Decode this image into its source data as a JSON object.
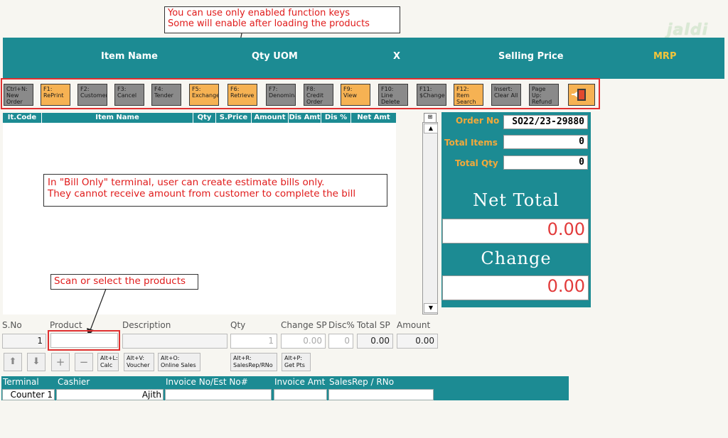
{
  "callouts": {
    "top_line1": "You can use only enabled function keys",
    "top_line2": "Some will enable after loading the products",
    "mid_line1": "In \"Bill Only\" terminal, user can create estimate bills only.",
    "mid_line2": "They cannot receive amount from customer to complete the bill",
    "scan": "Scan or select the products"
  },
  "logo": "jaldi",
  "header": {
    "item_name": "Item Name",
    "qty_uom": "Qty UOM",
    "x": "X",
    "selling_price": "Selling Price",
    "mrp": "MRP"
  },
  "fkeys": [
    {
      "line1": "Ctrl+N:",
      "line2": "New",
      "line3": "Order",
      "enabled": false
    },
    {
      "line1": "F1:",
      "line2": "RePrint",
      "line3": "",
      "enabled": true
    },
    {
      "line1": "F2:",
      "line2": "Customer",
      "line3": "",
      "enabled": false
    },
    {
      "line1": "F3:",
      "line2": "Cancel",
      "line3": "",
      "enabled": false
    },
    {
      "line1": "F4:",
      "line2": "Tender",
      "line3": "",
      "enabled": false
    },
    {
      "line1": "F5:",
      "line2": "Exchange",
      "line3": "",
      "enabled": true
    },
    {
      "line1": "F6:",
      "line2": "Retrieve",
      "line3": "",
      "enabled": true
    },
    {
      "line1": "F7:",
      "line2": "Denomina",
      "line3": "",
      "enabled": false
    },
    {
      "line1": "F8:",
      "line2": "Credit",
      "line3": "Order",
      "enabled": false
    },
    {
      "line1": "F9:",
      "line2": "View",
      "line3": "",
      "enabled": true
    },
    {
      "line1": "F10:",
      "line2": "Line",
      "line3": "Delete",
      "enabled": false
    },
    {
      "line1": "F11:",
      "line2": "$Change",
      "line3": "",
      "enabled": false
    },
    {
      "line1": "F12:",
      "line2": "Item",
      "line3": "Search",
      "enabled": true
    },
    {
      "line1": "Insert:",
      "line2": "Clear All",
      "line3": "",
      "enabled": false
    },
    {
      "line1": "Page Up:",
      "line2": "Refund",
      "line3": "",
      "enabled": false
    }
  ],
  "grid_columns": [
    "It.Code",
    "Item Name",
    "Qty",
    "S.Price",
    "Amount",
    "Dis Amt",
    "Dis %",
    "Net Amt"
  ],
  "summary": {
    "order_no_label": "Order No",
    "order_no": "SO22/23-29880",
    "total_items_label": "Total Items",
    "total_items": "0",
    "total_qty_label": "Total Qty",
    "total_qty": "0",
    "net_total_label": "Net Total",
    "net_total": "0.00",
    "change_label": "Change",
    "change": "0.00"
  },
  "entry": {
    "sno_label": "S.No",
    "product_label": "Product",
    "description_label": "Description",
    "qty_label": "Qty",
    "change_sp_label": "Change SP",
    "disc_label": "Disc%",
    "total_sp_label": "Total SP",
    "amount_label": "Amount",
    "sno": "1",
    "qty": "1",
    "change_sp": "0.00",
    "disc": "0",
    "total_sp": "0.00",
    "amount": "0.00"
  },
  "small_buttons": {
    "calc_l1": "Alt+L:",
    "calc_l2": "Calc",
    "voucher_l1": "Alt+V:",
    "voucher_l2": "Voucher",
    "online_l1": "Alt+O:",
    "online_l2": "Online Sales",
    "salesrep_l1": "Alt+R:",
    "salesrep_l2": "SalesRep/RNo",
    "getpts_l1": "Alt+P:",
    "getpts_l2": "Get Pts"
  },
  "footer": {
    "terminal_label": "Terminal",
    "cashier_label": "Cashier",
    "invoice_no_label": "Invoice No/Est No#",
    "invoice_amt_label": "Invoice Amt",
    "salesrep_label": "SalesRep / RNo",
    "terminal": "Counter 1",
    "cashier": "Ajith"
  },
  "colors": {
    "teal": "#1c8b93",
    "orange_label": "#f2a93b",
    "red_amount": "#e23b3b",
    "enabled_key": "#f6b253",
    "disabled_key": "#8a8a8a"
  }
}
